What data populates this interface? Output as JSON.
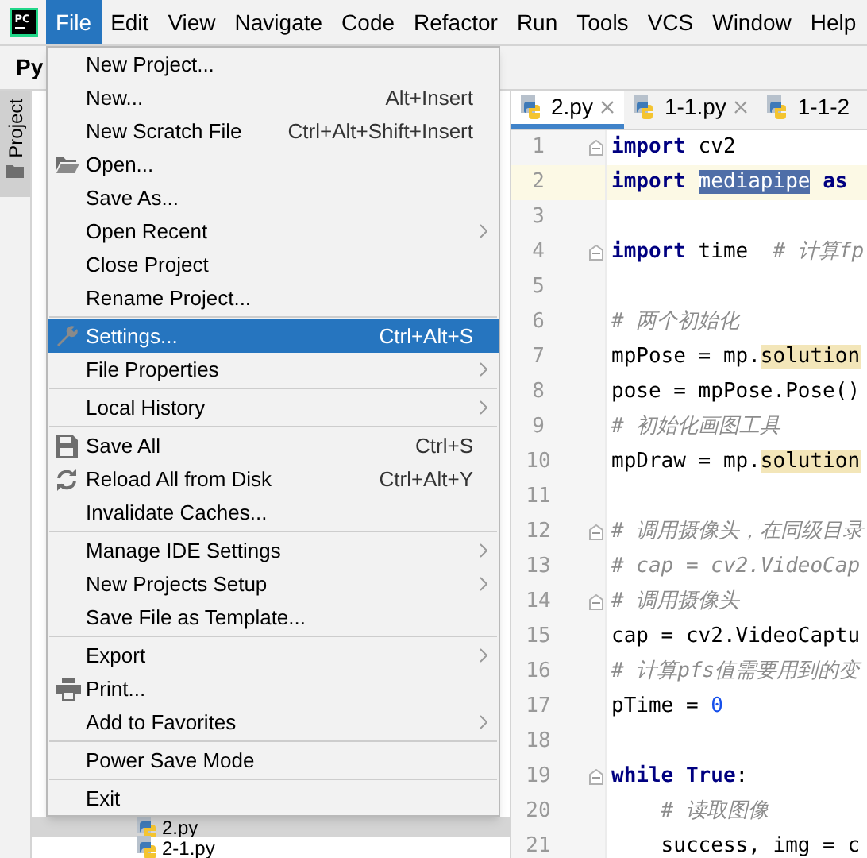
{
  "logo": "PC",
  "menu_bar": {
    "items": [
      {
        "label": "File",
        "selected": true
      },
      {
        "label": "Edit",
        "selected": false
      },
      {
        "label": "View",
        "selected": false
      },
      {
        "label": "Navigate",
        "selected": false
      },
      {
        "label": "Code",
        "selected": false
      },
      {
        "label": "Refactor",
        "selected": false
      },
      {
        "label": "Run",
        "selected": false
      },
      {
        "label": "Tools",
        "selected": false
      },
      {
        "label": "VCS",
        "selected": false
      },
      {
        "label": "Window",
        "selected": false
      },
      {
        "label": "Help",
        "selected": false
      }
    ]
  },
  "navigation_bar": {
    "project": "Py"
  },
  "tool_window_tab": {
    "label": "Project"
  },
  "project_panel": {
    "tree": [
      {
        "label": "2.py",
        "selected": true
      },
      {
        "label": "2-1.py",
        "selected": false
      }
    ]
  },
  "editor_tabs": [
    {
      "label": "2.py",
      "selected": true,
      "closable": true
    },
    {
      "label": "1-1.py",
      "selected": false,
      "closable": true
    },
    {
      "label": "1-1-2",
      "selected": false,
      "closable": false
    }
  ],
  "code_lines": [
    {
      "number": "1",
      "fold": true,
      "current": false,
      "tokens": [
        {
          "text": "import",
          "kind": "keyword"
        },
        {
          "text": " cv2",
          "kind": "plain"
        }
      ]
    },
    {
      "number": "2",
      "fold": false,
      "current": true,
      "tokens": [
        {
          "text": "import ",
          "kind": "keyword"
        },
        {
          "text": "mediapipe",
          "kind": "selection"
        },
        {
          "text": " as",
          "kind": "keyword"
        }
      ]
    },
    {
      "number": "3",
      "fold": false,
      "current": false
    },
    {
      "number": "4",
      "fold": true,
      "current": false,
      "tokens": [
        {
          "text": "import",
          "kind": "keyword"
        },
        {
          "text": " time  ",
          "kind": "plain"
        },
        {
          "text": "# 计算fp",
          "kind": "comment"
        }
      ]
    },
    {
      "number": "5",
      "fold": false,
      "current": false
    },
    {
      "number": "6",
      "fold": false,
      "current": false,
      "tokens": [
        {
          "text": "# 两个初始化",
          "kind": "comment"
        }
      ]
    },
    {
      "number": "7",
      "fold": false,
      "current": false,
      "tokens": [
        {
          "text": "mpPose = mp.",
          "kind": "plain"
        },
        {
          "text": "solution",
          "kind": "match"
        }
      ]
    },
    {
      "number": "8",
      "fold": false,
      "current": false,
      "tokens": [
        {
          "text": "pose = mpPose.Pose()",
          "kind": "plain"
        }
      ]
    },
    {
      "number": "9",
      "fold": false,
      "current": false,
      "tokens": [
        {
          "text": "# 初始化画图工具",
          "kind": "comment"
        }
      ]
    },
    {
      "number": "10",
      "fold": false,
      "current": false,
      "tokens": [
        {
          "text": "mpDraw = mp.",
          "kind": "plain"
        },
        {
          "text": "solution",
          "kind": "match"
        }
      ]
    },
    {
      "number": "11",
      "fold": false,
      "current": false
    },
    {
      "number": "12",
      "fold": true,
      "current": false,
      "tokens": [
        {
          "text": "# 调用摄像头，在同级目录",
          "kind": "comment"
        }
      ]
    },
    {
      "number": "13",
      "fold": false,
      "current": false,
      "tokens": [
        {
          "text": "# cap = cv2.VideoCap",
          "kind": "comment"
        }
      ]
    },
    {
      "number": "14",
      "fold": true,
      "current": false,
      "tokens": [
        {
          "text": "# 调用摄像头",
          "kind": "comment"
        }
      ]
    },
    {
      "number": "15",
      "fold": false,
      "current": false,
      "tokens": [
        {
          "text": "cap = cv2.VideoCaptu",
          "kind": "plain"
        }
      ]
    },
    {
      "number": "16",
      "fold": false,
      "current": false,
      "tokens": [
        {
          "text": "# 计算pfs值需要用到的变",
          "kind": "comment"
        }
      ]
    },
    {
      "number": "17",
      "fold": false,
      "current": false,
      "tokens": [
        {
          "text": "pTime = ",
          "kind": "plain"
        },
        {
          "text": "0",
          "kind": "number"
        }
      ]
    },
    {
      "number": "18",
      "fold": false,
      "current": false
    },
    {
      "number": "19",
      "fold": true,
      "current": false,
      "tokens": [
        {
          "text": "while True",
          "kind": "keyword"
        },
        {
          "text": ":",
          "kind": "plain"
        }
      ]
    },
    {
      "number": "20",
      "fold": false,
      "current": false,
      "tokens": [
        {
          "text": "    # 读取图像",
          "kind": "comment"
        }
      ]
    },
    {
      "number": "21",
      "fold": false,
      "current": false,
      "tokens": [
        {
          "text": "    success, img = c",
          "kind": "plain"
        }
      ]
    }
  ],
  "file_menu": {
    "groups": [
      {
        "items": [
          {
            "label": "New Project...",
            "submenu": false,
            "selected": false
          },
          {
            "label": "New...",
            "shortcut": "Alt+Insert",
            "submenu": false,
            "selected": false
          },
          {
            "label": "New Scratch File",
            "shortcut": "Ctrl+Alt+Shift+Insert",
            "submenu": false,
            "selected": false
          },
          {
            "label": "Open...",
            "kind": "folder",
            "submenu": false,
            "selected": false
          },
          {
            "label": "Save As...",
            "submenu": false,
            "selected": false
          },
          {
            "label": "Open Recent",
            "submenu": true,
            "selected": false
          },
          {
            "label": "Close Project",
            "submenu": false,
            "selected": false
          },
          {
            "label": "Rename Project...",
            "submenu": false,
            "selected": false
          }
        ]
      },
      {
        "items": [
          {
            "label": "Settings...",
            "shortcut": "Ctrl+Alt+S",
            "kind": "wrench",
            "submenu": false,
            "selected": true
          },
          {
            "label": "File Properties",
            "submenu": true,
            "selected": false
          }
        ]
      },
      {
        "items": [
          {
            "label": "Local History",
            "submenu": true,
            "selected": false
          }
        ]
      },
      {
        "items": [
          {
            "label": "Save All",
            "shortcut": "Ctrl+S",
            "kind": "disk",
            "submenu": false,
            "selected": false
          },
          {
            "label": "Reload All from Disk",
            "shortcut": "Ctrl+Alt+Y",
            "kind": "reload",
            "submenu": false,
            "selected": false
          },
          {
            "label": "Invalidate Caches...",
            "submenu": false,
            "selected": false
          }
        ]
      },
      {
        "items": [
          {
            "label": "Manage IDE Settings",
            "submenu": true,
            "selected": false
          },
          {
            "label": "New Projects Setup",
            "submenu": true,
            "selected": false
          },
          {
            "label": "Save File as Template...",
            "submenu": false,
            "selected": false
          }
        ]
      },
      {
        "items": [
          {
            "label": "Export",
            "submenu": true,
            "selected": false
          },
          {
            "label": "Print...",
            "kind": "printer",
            "submenu": false,
            "selected": false
          },
          {
            "label": "Add to Favorites",
            "submenu": true,
            "selected": false
          }
        ]
      },
      {
        "items": [
          {
            "label": "Power Save Mode",
            "submenu": false,
            "selected": false
          }
        ]
      },
      {
        "items": [
          {
            "label": "Exit",
            "submenu": false,
            "selected": false
          }
        ]
      }
    ]
  }
}
